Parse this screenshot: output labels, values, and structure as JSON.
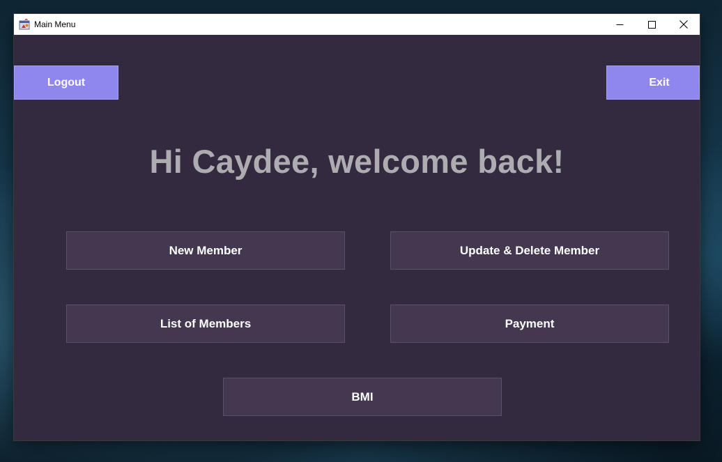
{
  "window": {
    "title": "Main Menu"
  },
  "header_buttons": {
    "logout_label": "Logout",
    "exit_label": "Exit"
  },
  "welcome": {
    "text": "Hi Caydee, welcome back!"
  },
  "menu": {
    "new_member": "New Member",
    "update_delete_member": "Update & Delete Member",
    "list_of_members": "List of Members",
    "payment": "Payment",
    "bmi": "BMI"
  },
  "colors": {
    "background": "#332a3f",
    "accent_button": "#8f86ee",
    "menu_button": "#43384f",
    "welcome_text": "#adadb1"
  },
  "icons": {
    "app": "java-app-icon",
    "minimize": "minimize-icon",
    "maximize": "maximize-icon",
    "close": "close-icon"
  }
}
